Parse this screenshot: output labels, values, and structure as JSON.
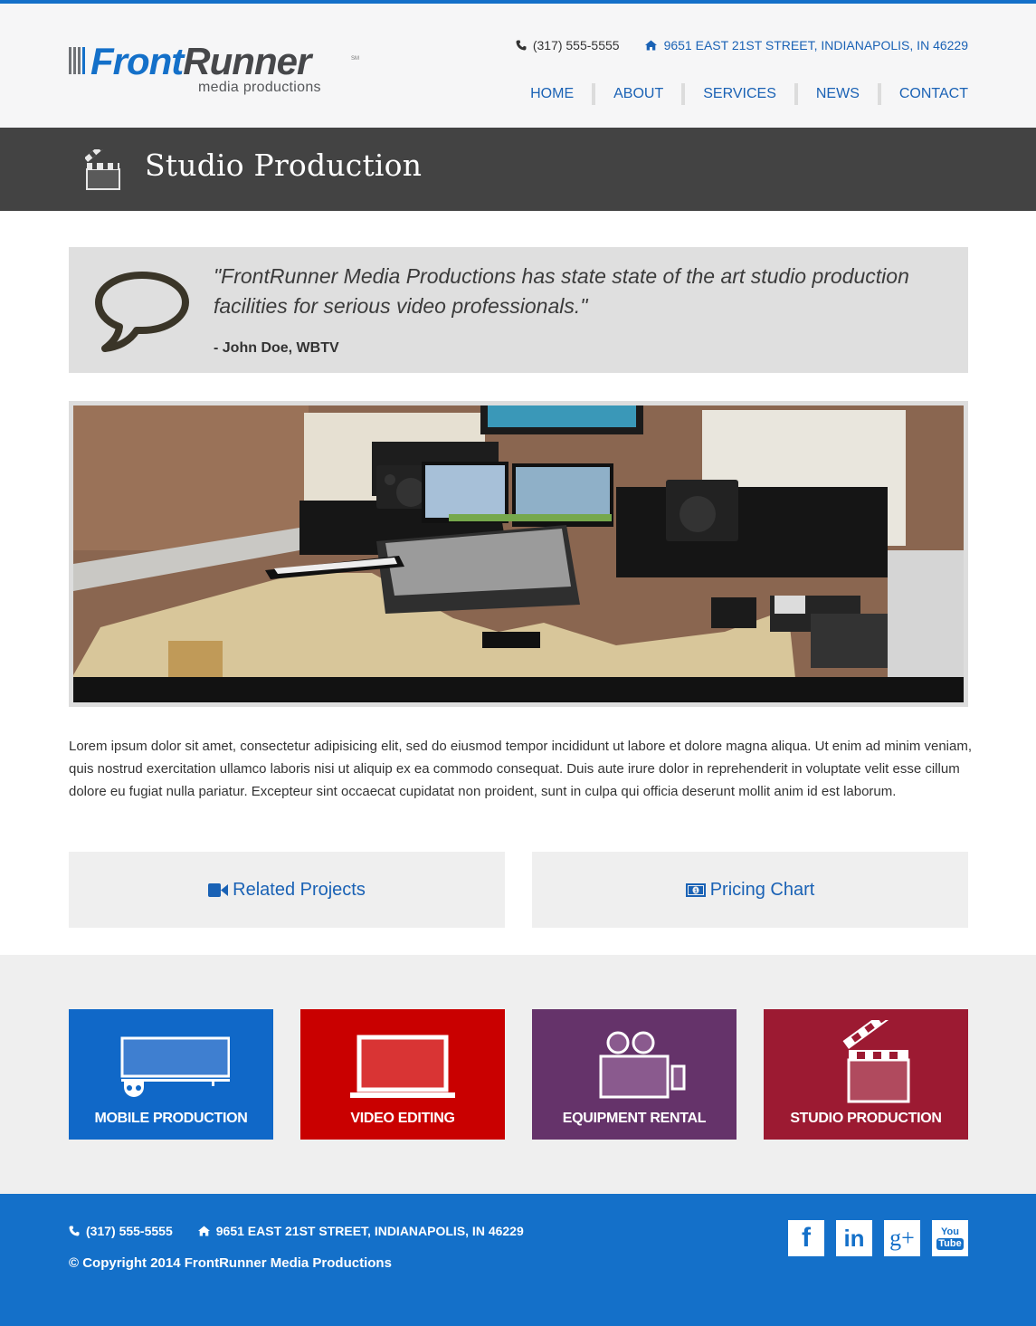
{
  "brand": {
    "name_part1": "Front",
    "name_part2": "Runner",
    "trademark": "SM",
    "tagline": "media productions",
    "accent_color": "#1470c9"
  },
  "header": {
    "phone": "(317) 555-5555",
    "address": "9651 EAST 21ST STREET, INDIANAPOLIS, IN 46229",
    "nav": [
      {
        "label": "HOME"
      },
      {
        "label": "ABOUT"
      },
      {
        "label": "SERVICES"
      },
      {
        "label": "NEWS"
      },
      {
        "label": "CONTACT"
      }
    ]
  },
  "page": {
    "title": "Studio Production",
    "title_icon": "clapperboard-icon"
  },
  "testimonial": {
    "icon": "speech-bubble-icon",
    "quote": "\"FrontRunner Media Productions has state state of the art studio production facilities for serious video professionals.\"",
    "author": "- John Doe, WBTV"
  },
  "photo": {
    "alt": "Recording studio with mixing console, monitors, speakers and keyboard"
  },
  "body": {
    "paragraph": "Lorem ipsum dolor sit amet, consectetur adipisicing elit, sed do eiusmod tempor incididunt ut labore et dolore magna aliqua. Ut enim ad minim veniam, quis nostrud exercitation ullamco laboris nisi ut aliquip ex ea commodo consequat. Duis aute irure dolor in reprehenderit in voluptate velit esse cillum dolore eu fugiat nulla pariatur. Excepteur sint occaecat cupidatat non proident, sunt in culpa qui officia deserunt mollit anim id est laborum."
  },
  "actions": {
    "related_projects": {
      "label": "Related Projects",
      "icon": "video-camera-icon"
    },
    "pricing_chart": {
      "label": "Pricing Chart",
      "icon": "money-icon"
    }
  },
  "services": [
    {
      "label": "MOBILE PRODUCTION",
      "icon": "trailer-icon",
      "color": "#1068c8"
    },
    {
      "label": "VIDEO EDITING",
      "icon": "laptop-icon",
      "color": "#c90000"
    },
    {
      "label": "EQUIPMENT RENTAL",
      "icon": "film-camera-icon",
      "color": "#65336a"
    },
    {
      "label": "STUDIO PRODUCTION",
      "icon": "clapperboard-icon",
      "color": "#9c1a32"
    }
  ],
  "footer": {
    "phone": "(317) 555-5555",
    "address": "9651 EAST 21ST STREET, INDIANAPOLIS, IN 46229",
    "copyright": "© Copyright 2014 FrontRunner Media Productions",
    "social": [
      {
        "name": "facebook",
        "glyph": "f"
      },
      {
        "name": "linkedin",
        "glyph": "in"
      },
      {
        "name": "google-plus",
        "glyph": "g+"
      },
      {
        "name": "youtube",
        "glyph_top": "You",
        "glyph_bottom": "Tube"
      }
    ]
  }
}
